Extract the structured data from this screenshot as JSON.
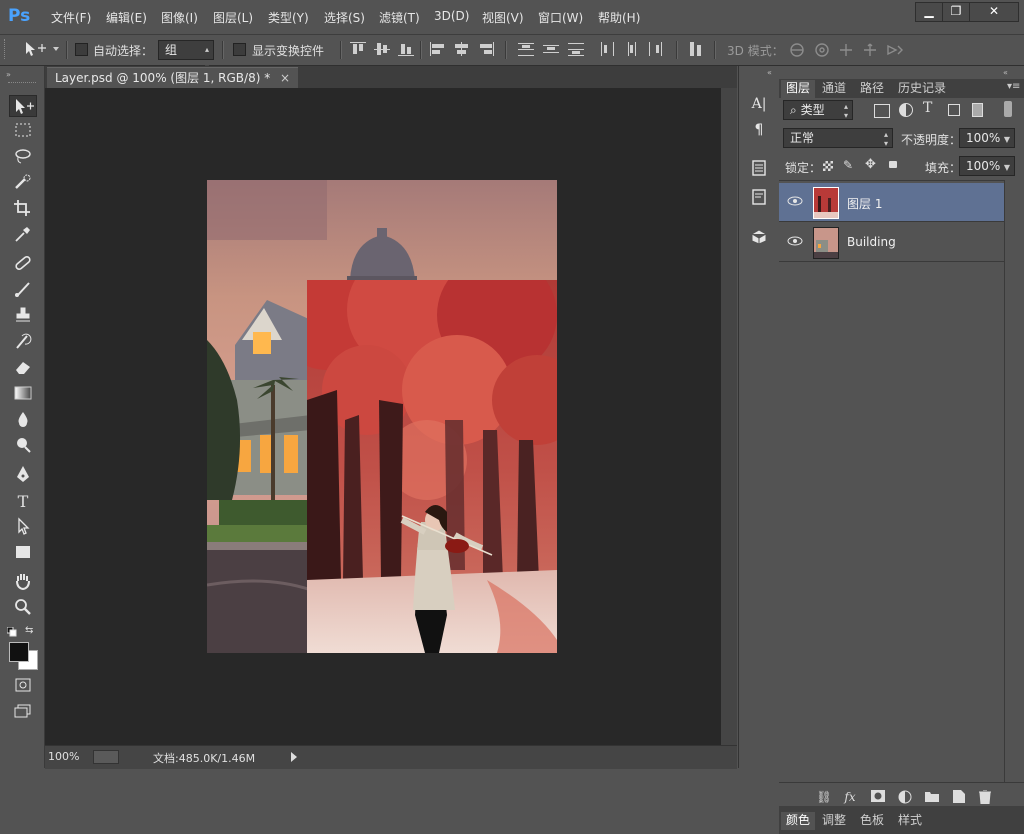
{
  "app": {
    "logo": "Ps"
  },
  "menu": [
    "文件(F)",
    "编辑(E)",
    "图像(I)",
    "图层(L)",
    "类型(Y)",
    "选择(S)",
    "滤镜(T)",
    "3D(D)",
    "视图(V)",
    "窗口(W)",
    "帮助(H)"
  ],
  "window_controls": {
    "minimize": "▁",
    "maximize": "❐",
    "close": "✕"
  },
  "options": {
    "auto_select_label": "自动选择：",
    "auto_select_value": "组",
    "show_transform_label": "显示变换控件",
    "mode_3d_label": "3D 模式："
  },
  "document": {
    "tab_title": "Layer.psd @ 100% (图层 1, RGB/8) *",
    "tab_close": "×",
    "zoom": "100%",
    "doc_info": "文档:485.0K/1.46M"
  },
  "panels": {
    "tabs": [
      "图层",
      "通道",
      "路径",
      "历史记录"
    ],
    "filter_kind": "类型",
    "blend_mode": "正常",
    "opacity_label": "不透明度：",
    "opacity_value": "100%",
    "lock_label": "锁定：",
    "fill_label": "填充：",
    "fill_value": "100%",
    "layers": [
      {
        "name": "图层 1",
        "selected": true
      },
      {
        "name": "Building",
        "selected": false
      }
    ],
    "bottom_tabs": [
      "颜色",
      "调整",
      "色板",
      "样式"
    ]
  },
  "colors": {
    "ui_bg": "#535353",
    "canvas_bg": "#282828",
    "selected_layer": "#5f7193",
    "foreground": "#111111",
    "background": "#ffffff"
  }
}
